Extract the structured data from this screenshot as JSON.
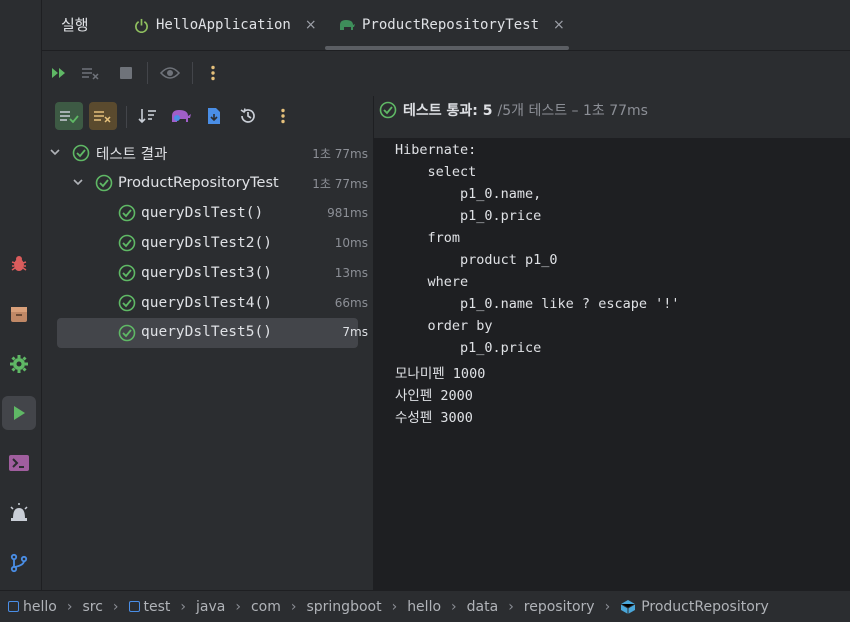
{
  "topbar": {
    "run_title": "실행",
    "tabs": [
      {
        "label": "HelloApplication",
        "icon": "power-icon"
      },
      {
        "label": "ProductRepositoryTest",
        "icon": "gradle-elephant-icon"
      }
    ],
    "close_glyph": "×"
  },
  "status": {
    "passed_label": "테스트 통과: 5",
    "total_label": "/5개 테스트 – 1초 77ms"
  },
  "tree": {
    "root": {
      "label": "테스트 결과",
      "time": "1초 77ms"
    },
    "class_node": {
      "label": "ProductRepositoryTest",
      "time": "1초 77ms"
    },
    "tests": [
      {
        "label": "queryDslTest()",
        "time": "981ms"
      },
      {
        "label": "queryDslTest2()",
        "time": "10ms"
      },
      {
        "label": "queryDslTest3()",
        "time": "13ms"
      },
      {
        "label": "queryDslTest4()",
        "time": "66ms"
      },
      {
        "label": "queryDslTest5()",
        "time": "7ms",
        "selected": true
      }
    ]
  },
  "console": {
    "lines": [
      "Hibernate: ",
      "    select",
      "        p1_0.name,",
      "        p1_0.price ",
      "    from",
      "        product p1_0 ",
      "    where",
      "        p1_0.name like ? escape '!' ",
      "    order by",
      "        p1_0.price",
      "모나미펜 1000",
      "사인펜 2000",
      "수성펜 3000"
    ]
  },
  "breadcrumb": {
    "items": [
      "hello",
      "src",
      "test",
      "java",
      "com",
      "springboot",
      "hello",
      "data",
      "repository",
      "ProductRepository"
    ]
  },
  "colors": {
    "accent_green": "#5fb865",
    "run_green": "#57a64a",
    "bug_red": "#db5c5c",
    "warn_yellow": "#e5c07b",
    "blue": "#4a8ee6"
  }
}
